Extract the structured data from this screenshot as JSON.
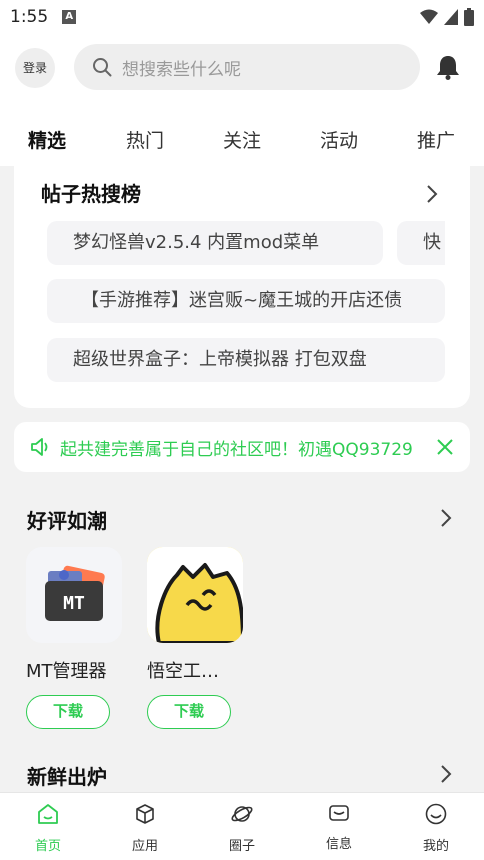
{
  "status_bar": {
    "time": "1:55",
    "notif_icon": "A"
  },
  "header": {
    "login_label": "登录",
    "search_placeholder": "想搜索些什么呢"
  },
  "tabs": [
    {
      "label": "精选",
      "active": true
    },
    {
      "label": "热门"
    },
    {
      "label": "关注"
    },
    {
      "label": "活动"
    },
    {
      "label": "推广"
    }
  ],
  "hot_search": {
    "title": "帖子热搜榜",
    "items": [
      "梦幻怪兽v2.5.4 内置mod菜单",
      "快",
      "【手游推荐】迷宫贩~魔王城的开店还债",
      "超级世界盒子：上帝模拟器 打包双盘"
    ]
  },
  "notice": {
    "text": "起共建完善属于自己的社区吧！初遇QQ93729"
  },
  "good_reviews": {
    "title": "好评如潮",
    "apps": [
      {
        "name": "MT管理器",
        "download_label": "下载"
      },
      {
        "name": "悟空工…",
        "download_label": "下载"
      }
    ]
  },
  "fresh": {
    "title": "新鲜出炉"
  },
  "bottom_nav": [
    {
      "label": "首页",
      "active": true
    },
    {
      "label": "应用"
    },
    {
      "label": "圈子"
    },
    {
      "label": "信息"
    },
    {
      "label": "我的"
    }
  ],
  "colors": {
    "accent": "#2ecc52"
  }
}
